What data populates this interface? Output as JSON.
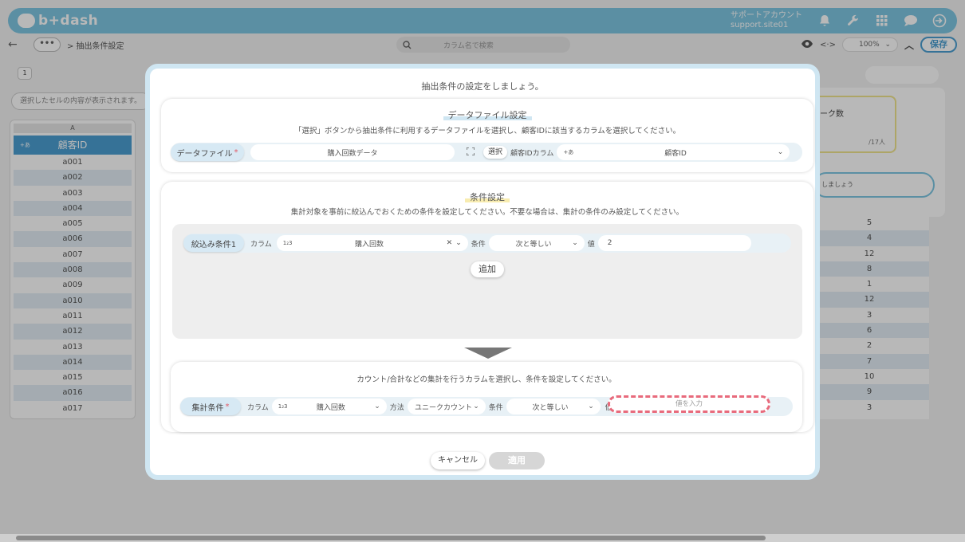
{
  "header": {
    "logo_text": "b+dash",
    "account_line1": "サポートアカウント",
    "account_line2": "support.site01",
    "icons": [
      "bell-icon",
      "wrench-icon",
      "grid-icon",
      "chat-icon",
      "logout-icon"
    ]
  },
  "subbar": {
    "menu_dots": "•••",
    "breadcrumb": "> 抽出条件設定",
    "search_placeholder": "カラム名で検索",
    "zoom": "100%",
    "save_label": "保存"
  },
  "sheet": {
    "tab": "1",
    "cell_info": "選択したセルの内容が表示されます。",
    "column_letter": "A",
    "column_header": "顧客ID",
    "column_tag": "+あ",
    "rows": [
      "a001",
      "a002",
      "a003",
      "a004",
      "a005",
      "a006",
      "a007",
      "a008",
      "a009",
      "a010",
      "a011",
      "a012",
      "a013",
      "a014",
      "a015",
      "a016",
      "a017"
    ],
    "right_values": [
      "5",
      "4",
      "12",
      "8",
      "1",
      "12",
      "3",
      "6",
      "2",
      "7",
      "10",
      "9",
      "3"
    ],
    "side_card_title": "ーク数",
    "side_card_count": "/17人",
    "side_input_text": "しましょう"
  },
  "modal": {
    "title": "抽出条件の設定をしましょう。",
    "datafile": {
      "title": "データファイル設定",
      "desc": "「選択」ボタンから抽出条件に利用するデータファイルを選択し、顧客IDに該当するカラムを選択してください。",
      "label": "データファイル",
      "required": "*",
      "value": "購入回数データ",
      "select_button": "選択",
      "id_column_label": "顧客IDカラム",
      "id_column_tag": "+あ",
      "id_column_value": "顧客ID"
    },
    "condition": {
      "title": "条件設定",
      "desc": "集計対象を事前に絞込んでおくための条件を設定してください。不要な場合は、集計の条件のみ設定してください。",
      "filter_label": "絞込み条件1",
      "column_label": "カラム",
      "column_tag": "1₂3",
      "column_value": "購入回数",
      "clear": "✕",
      "cond_label": "条件",
      "cond_value": "次と等しい",
      "value_label": "値",
      "value": "2",
      "add_button": "追加"
    },
    "aggregate": {
      "desc": "カウント/合計などの集計を行うカラムを選択し、条件を設定してください。",
      "label": "集計条件",
      "required": "*",
      "column_label": "カラム",
      "column_tag": "1₂3",
      "column_value": "購入回数",
      "method_label": "方法",
      "method_value": "ユニークカウント",
      "cond_label": "条件",
      "cond_value": "次と等しい",
      "value_label": "値",
      "value_placeholder": "値を入力"
    },
    "cancel_label": "キャンセル",
    "apply_label": "適用"
  }
}
